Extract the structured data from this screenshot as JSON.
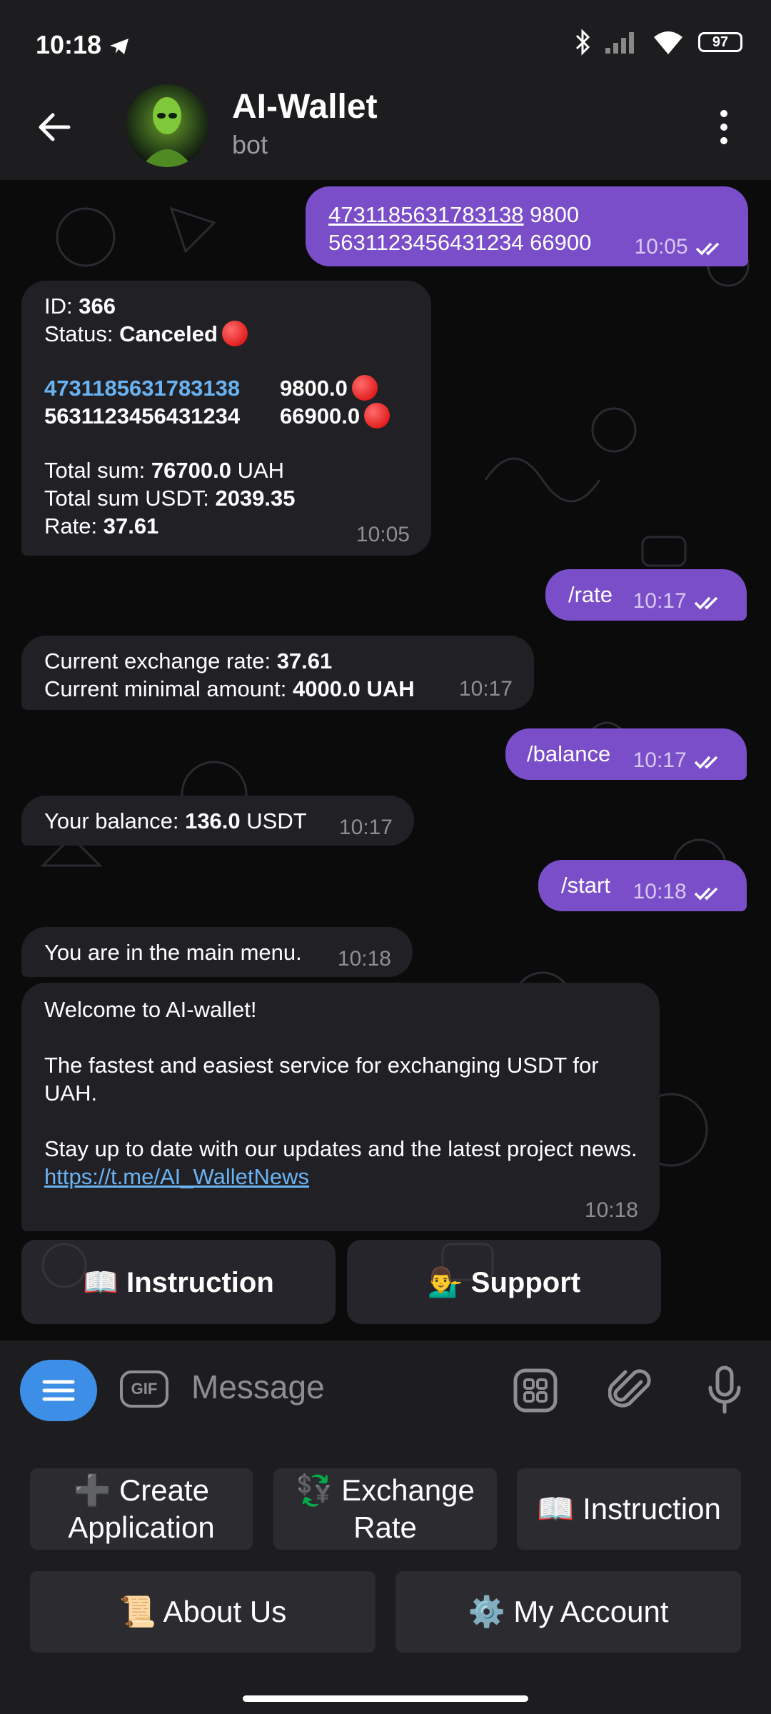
{
  "status_bar": {
    "time": "10:18",
    "battery": "97"
  },
  "header": {
    "title": "AI-Wallet",
    "subtitle": "bot"
  },
  "messages": {
    "m1": {
      "card1": "4731185631783138",
      "line1_rest": " 9800",
      "line2": "5631123456431234 66900",
      "time": "10:05"
    },
    "m2": {
      "id_label": "ID: ",
      "id_value": "366",
      "status_label": "Status: ",
      "status_value": "Canceled",
      "card1": "4731185631783138",
      "amount1": "9800.0",
      "card2": "5631123456431234",
      "amount2": "66900.0",
      "total_label": "Total sum: ",
      "total_value": "76700.0",
      "total_unit": " UAH",
      "total_usdt_label": "Total sum USDT: ",
      "total_usdt_value": "2039.35",
      "rate_label": "Rate: ",
      "rate_value": "37.61",
      "time": "10:05"
    },
    "m3": {
      "text": "/rate",
      "time": "10:17"
    },
    "m4": {
      "l1_label": "Current exchange rate: ",
      "l1_value": "37.61",
      "l2_label": "Current minimal amount: ",
      "l2_value": "4000.0 UAH",
      "time": "10:17"
    },
    "m5": {
      "text": "/balance",
      "time": "10:17"
    },
    "m6": {
      "label": "Your balance: ",
      "value": "136.0",
      "unit": " USDT",
      "time": "10:17"
    },
    "m7": {
      "text": "/start",
      "time": "10:18"
    },
    "m8": {
      "text": "You are in the main menu.",
      "time": "10:18"
    },
    "m9": {
      "p1": "Welcome to AI-wallet!",
      "p2": "The fastest and easiest service for exchanging USDT for UAH.",
      "p3": "Stay up to date with our updates and the latest project news.",
      "link": "https://t.me/AI_WalletNews",
      "time": "10:18"
    }
  },
  "inline_buttons": {
    "instruction": "📖 Instruction",
    "support": "💁‍♂️ Support"
  },
  "input": {
    "placeholder": "Message",
    "gif": "GIF"
  },
  "keyboard": {
    "create_line1": "➕ Create",
    "create_line2": "Application",
    "exchange_line1": "💱 Exchange",
    "exchange_line2": "Rate",
    "instruction": "📖 Instruction",
    "about": "📜 About Us",
    "account": "⚙️ My Account"
  }
}
